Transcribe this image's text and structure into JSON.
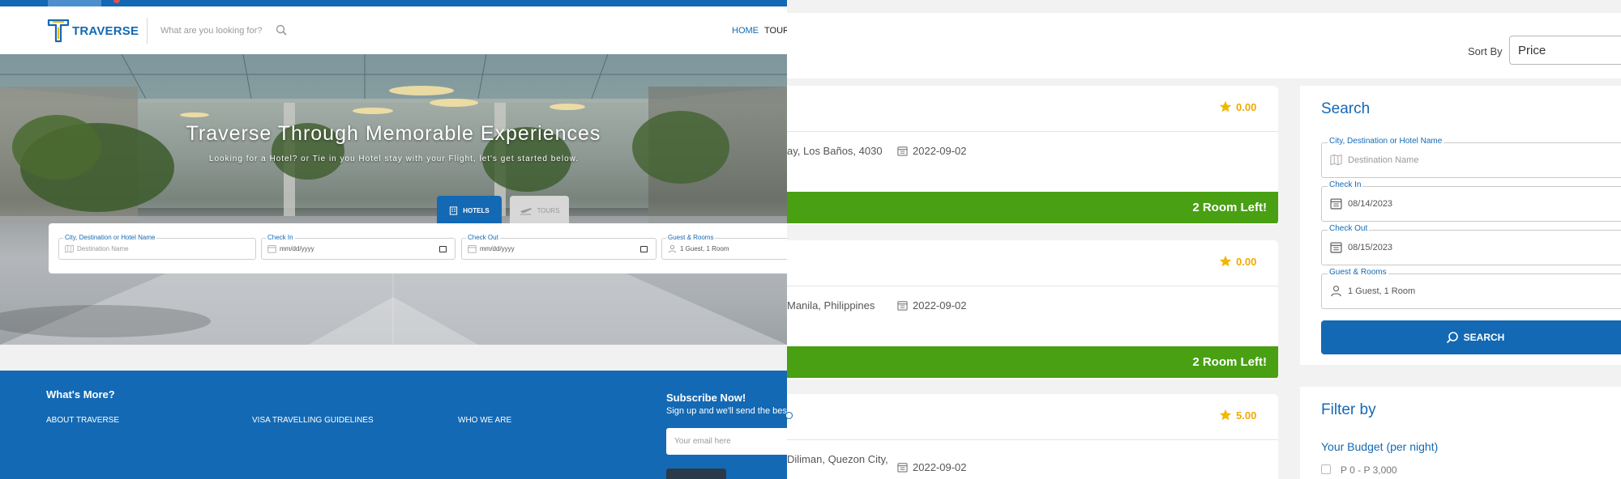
{
  "colors": {
    "brand_blue": "#1469b4",
    "available_green": "#48a012",
    "rating_gold": "#f2a900"
  },
  "left_page": {
    "header": {
      "brand_name": "TRAVERSE",
      "search_placeholder": "What are you looking for?",
      "nav": [
        "HOME",
        "TOUR"
      ]
    },
    "hero": {
      "title": "Traverse Through Memorable Experiences",
      "subtitle": "Looking for a Hotel? or Tie in you Hotel stay with your Flight, let's get started below.",
      "tabs": [
        {
          "label": "HOTELS",
          "icon": "hotel-icon",
          "active": true
        },
        {
          "label": "TOURS",
          "icon": "plane-icon",
          "active": false
        }
      ]
    },
    "search_form": {
      "destination": {
        "label": "City, Destination or Hotel Name",
        "placeholder": "Destination Name",
        "icon": "map-icon"
      },
      "check_in": {
        "label": "Check In",
        "value": "mm/dd/yyyy",
        "icon": "calendar-icon"
      },
      "check_out": {
        "label": "Check Out",
        "value": "mm/dd/yyyy",
        "icon": "calendar-icon"
      },
      "guests": {
        "label": "Guest & Rooms",
        "value": "1 Guest, 1 Room",
        "icon": "user-icon"
      }
    },
    "footer": {
      "title": "What's More?",
      "links": [
        "ABOUT TRAVERSE",
        "VISA TRAVELLING GUIDELINES",
        "WHO WE ARE"
      ],
      "subscribe_title": "Subscribe Now!",
      "subscribe_text": "Sign up and we'll send the bes",
      "email_placeholder": "Your email here"
    }
  },
  "right_page": {
    "sort": {
      "label": "Sort By",
      "value": "Price"
    },
    "results": [
      {
        "rating": "0.00",
        "address": "ay, Los Baños, 4030",
        "date": "2022-09-02",
        "availability": "2 Room Left!"
      },
      {
        "rating": "0.00",
        "address": "Manila, Philippines",
        "date": "2022-09-02",
        "availability": "2 Room Left!"
      },
      {
        "rating": "5.00",
        "address": "Diliman, Quezon City,",
        "date": "2022-09-02",
        "availability": ""
      }
    ],
    "search_panel": {
      "title": "Search",
      "destination": {
        "label": "City, Destination or Hotel Name",
        "placeholder": "Destination Name"
      },
      "check_in": {
        "label": "Check In",
        "value": "08/14/2023"
      },
      "check_out": {
        "label": "Check Out",
        "value": "08/15/2023"
      },
      "guests": {
        "label": "Guest & Rooms",
        "value": "1 Guest, 1 Room"
      },
      "button": "SEARCH"
    },
    "filter_panel": {
      "title": "Filter by",
      "budget_title": "Your Budget (per night)",
      "budget_first_option": "P 0 - P 3,000"
    }
  }
}
